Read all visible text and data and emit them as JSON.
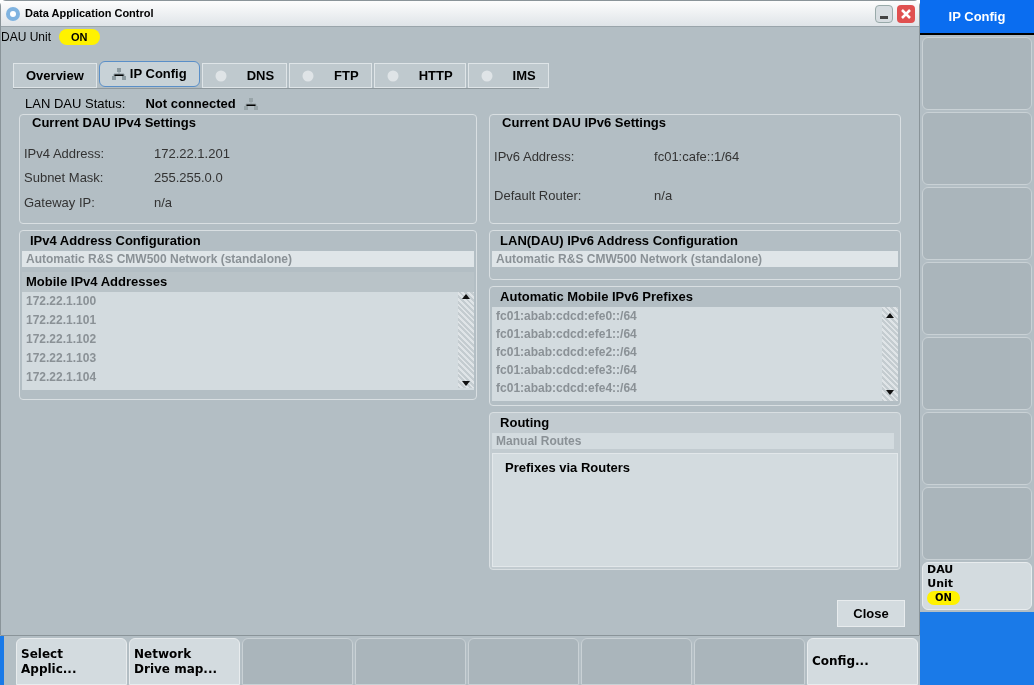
{
  "window": {
    "title": "Data Application Control"
  },
  "dau_unit": {
    "label": "DAU Unit",
    "value": "ON",
    "on": true
  },
  "tabs": [
    {
      "label": "Overview",
      "kind": "plain",
      "selected": false
    },
    {
      "label": "IP Config",
      "kind": "network",
      "selected": true
    },
    {
      "label": "DNS",
      "kind": "led",
      "selected": false
    },
    {
      "label": "FTP",
      "kind": "led",
      "selected": false
    },
    {
      "label": "HTTP",
      "kind": "led",
      "selected": false
    },
    {
      "label": "IMS",
      "kind": "led",
      "selected": false
    }
  ],
  "lan_status": {
    "label": "LAN DAU Status:",
    "value": "Not connected"
  },
  "ipv4_settings": {
    "title": "Current DAU IPv4 Settings",
    "fields": [
      {
        "label": "IPv4 Address:",
        "value": "172.22.1.201"
      },
      {
        "label": "Subnet Mask:",
        "value": "255.255.0.0"
      },
      {
        "label": "Gateway IP:",
        "value": "n/a"
      }
    ]
  },
  "ipv6_settings": {
    "title": "Current DAU IPv6 Settings",
    "fields": [
      {
        "label": "IPv6 Address:",
        "value": "fc01:cafe::1/64"
      },
      {
        "label": "Default Router:",
        "value": "n/a"
      }
    ]
  },
  "ipv4_config": {
    "title": "IPv4 Address Configuration",
    "mode": "Automatic R&S CMW500 Network (standalone)",
    "list_title": "Mobile IPv4 Addresses",
    "items": [
      "172.22.1.100",
      "172.22.1.101",
      "172.22.1.102",
      "172.22.1.103",
      "172.22.1.104"
    ]
  },
  "ipv6_config": {
    "title": "LAN(DAU) IPv6 Address Configuration",
    "mode": "Automatic R&S CMW500 Network (standalone)"
  },
  "ipv6_prefixes": {
    "title": "Automatic Mobile IPv6 Prefixes",
    "items": [
      "fc01:abab:cdcd:efe0::/64",
      "fc01:abab:cdcd:efe1::/64",
      "fc01:abab:cdcd:efe2::/64",
      "fc01:abab:cdcd:efe3::/64",
      "fc01:abab:cdcd:efe4::/64"
    ]
  },
  "routing": {
    "title": "Routing",
    "mode": "Manual Routes",
    "list_title": "Prefixes via Routers"
  },
  "close_button": "Close",
  "side_softkeys": {
    "title": "IP Config",
    "buttons": [
      {
        "kind": "blank"
      },
      {
        "kind": "blank"
      },
      {
        "kind": "blank"
      },
      {
        "kind": "blank"
      },
      {
        "kind": "blank"
      },
      {
        "kind": "blank"
      },
      {
        "kind": "blank"
      },
      {
        "kind": "toggle",
        "label": "DAU\nUnit",
        "value": "ON",
        "on": true
      }
    ]
  },
  "bottom_softkeys": [
    {
      "kind": "label",
      "label": "Select\nApplic..."
    },
    {
      "kind": "label",
      "label": "Network\nDrive map..."
    },
    {
      "kind": "blank"
    },
    {
      "kind": "blank"
    },
    {
      "kind": "blank"
    },
    {
      "kind": "blank"
    },
    {
      "kind": "blank"
    },
    {
      "kind": "label",
      "label": "Config..."
    }
  ]
}
